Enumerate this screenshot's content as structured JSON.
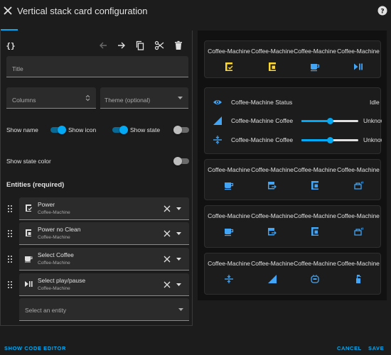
{
  "dialog": {
    "title": "Vertical stack card configuration",
    "close_icon": "close-icon",
    "help_icon": "help-circle-icon"
  },
  "editor": {
    "code_icon": "code-braces-icon",
    "toolbar_icons": [
      "arrow-left-icon",
      "arrow-right-icon",
      "copy-icon",
      "cut-icon",
      "delete-icon"
    ],
    "title_label": "Title",
    "columns_label": "Columns",
    "theme_label": "Theme (optional)",
    "toggles": {
      "show_name": {
        "label": "Show name",
        "on": true
      },
      "show_icon": {
        "label": "Show icon",
        "on": true
      },
      "show_state": {
        "label": "Show state",
        "on": false
      },
      "show_state_color": {
        "label": "Show state color",
        "on": false
      }
    },
    "entities_title": "Entities (required)",
    "entities": [
      {
        "name": "Power",
        "sub": "Coffee-Machine",
        "icon": "coffee-maker-check-icon"
      },
      {
        "name": "Power no Clean",
        "sub": "Coffee-Machine",
        "icon": "coffee-maker-icon"
      },
      {
        "name": "Select Coffee",
        "sub": "Coffee-Machine",
        "icon": "coffee-icon"
      },
      {
        "name": "Select play/pause",
        "sub": "Coffee-Machine",
        "icon": "play-pause-icon"
      }
    ],
    "select_entity_placeholder": "Select an entity"
  },
  "preview": {
    "card1": {
      "names": [
        "Coffee-Machine",
        "Coffee-Machine",
        "Coffee-Machine",
        "Coffee-Machine"
      ],
      "icons": [
        "coffee-maker-check-icon",
        "coffee-maker-icon",
        "coffee-icon",
        "play-pause-icon"
      ]
    },
    "card2": {
      "rows": [
        {
          "name": "Coffee-Machine Status",
          "state": "Idle",
          "icon": "eye-icon"
        },
        {
          "name": "Coffee-Machine Coffee",
          "state": "Unknown",
          "icon": "signal-icon",
          "slider": 0.5
        },
        {
          "name": "Coffee-Machine Coffee",
          "state": "Unknown",
          "icon": "adjust-icon",
          "slider": 0.5
        }
      ]
    },
    "card3": {
      "names": [
        "Coffee-Machine",
        "Coffee-Machine",
        "Coffee-Machine",
        "Coffee-Machine"
      ],
      "icons": [
        "coffee-icon",
        "coffee-to-go-icon",
        "coffee-maker-icon",
        "kettle-steam-icon"
      ]
    },
    "card4": {
      "names": [
        "Coffee-Machine",
        "Coffee-Machine",
        "Coffee-Machine",
        "Coffee-Machine"
      ],
      "icons": [
        "coffee-icon",
        "coffee-to-go-icon",
        "coffee-maker-icon",
        "kettle-steam-icon"
      ]
    },
    "card5": {
      "names": [
        "Coffee-Machine",
        "Coffee-Machine",
        "Coffee-Machine",
        "Coffee-Machine"
      ],
      "icons": [
        "adjust-icon",
        "signal-icon",
        "water-boiler-icon",
        "spray-bottle-icon"
      ]
    }
  },
  "footer": {
    "show_code_editor": "SHOW CODE EDITOR",
    "cancel": "CANCEL",
    "save": "SAVE"
  },
  "colors": {
    "accent": "#03a9f4",
    "active_icon": "#fdd835",
    "background": "#1c1c1c",
    "field": "#2b2b2b"
  }
}
